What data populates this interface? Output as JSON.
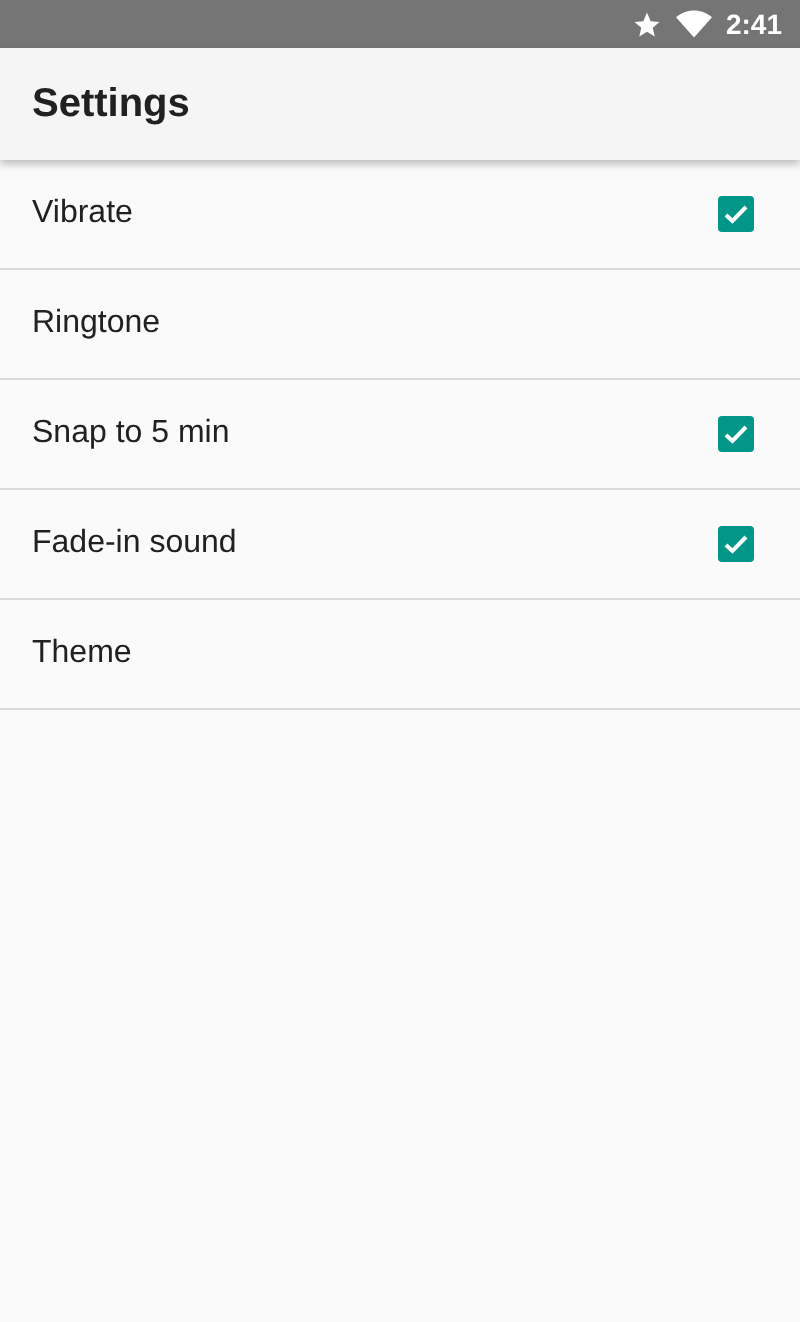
{
  "status_bar": {
    "time": "2:41"
  },
  "app_bar": {
    "title": "Settings"
  },
  "items": [
    {
      "label": "Vibrate",
      "kind": "checkbox",
      "checked": true
    },
    {
      "label": "Ringtone",
      "kind": "link"
    },
    {
      "label": "Snap to 5 min",
      "kind": "checkbox",
      "checked": true
    },
    {
      "label": "Fade-in sound",
      "kind": "checkbox",
      "checked": true
    },
    {
      "label": "Theme",
      "kind": "link"
    }
  ]
}
